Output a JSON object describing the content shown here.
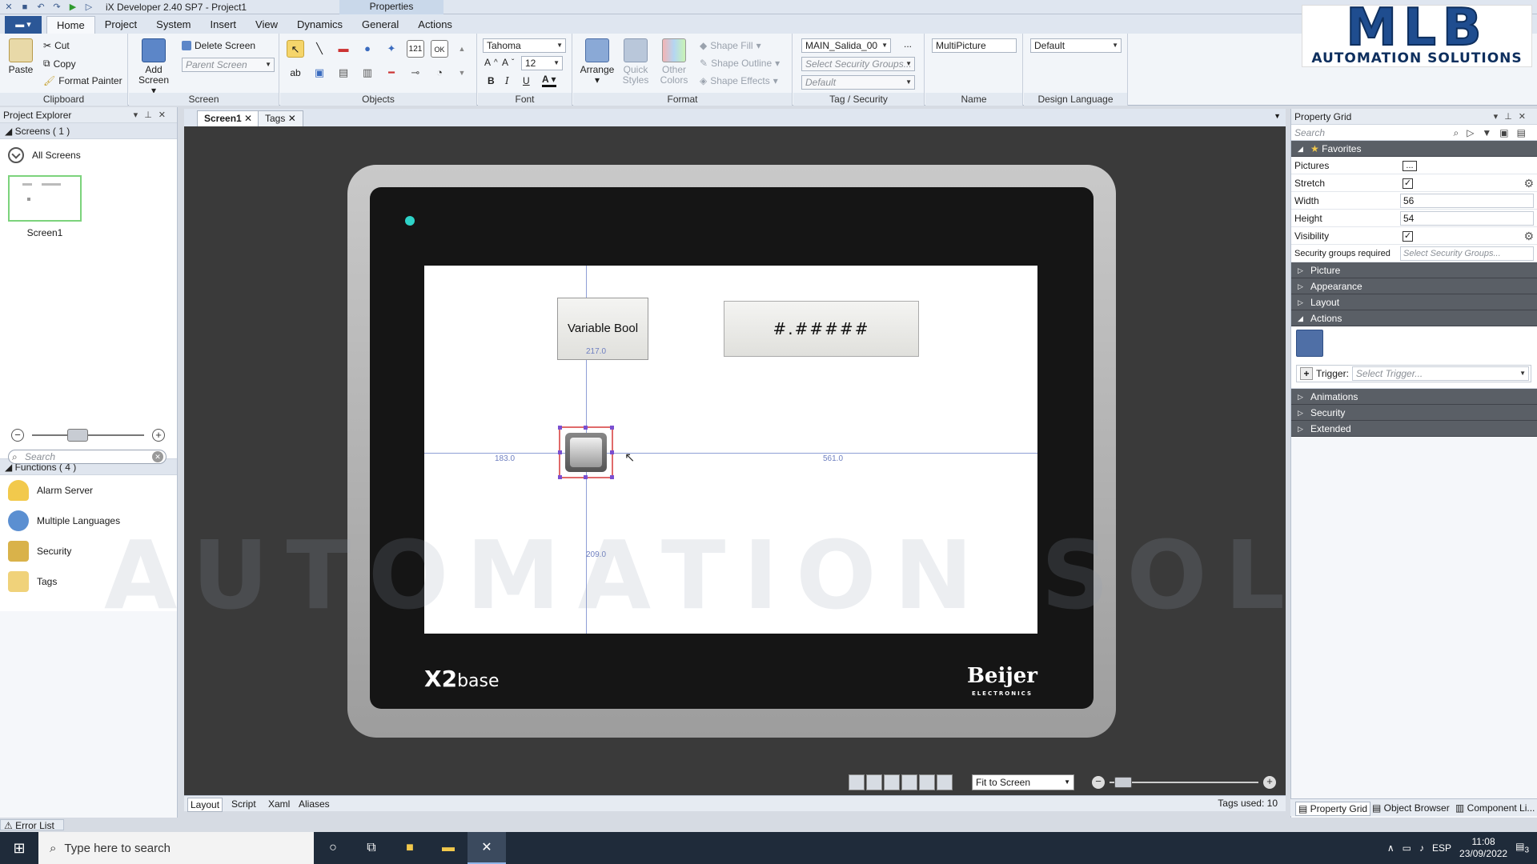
{
  "window": {
    "title": "iX Developer 2.40 SP7 - Project1",
    "context_tab": "Properties"
  },
  "ribbon_tabs": [
    "Home",
    "Project",
    "System",
    "Insert",
    "View",
    "Dynamics",
    "General",
    "Actions"
  ],
  "ribbon": {
    "clipboard": {
      "paste": "Paste",
      "cut": "Cut",
      "copy": "Copy",
      "format_painter": "Format Painter",
      "label": "Clipboard"
    },
    "screen": {
      "add_screen": "Add Screen",
      "delete_screen": "Delete Screen",
      "parent_screen": "Parent Screen",
      "label": "Screen"
    },
    "objects": {
      "label": "Objects"
    },
    "font": {
      "family": "Tahoma",
      "size": "12",
      "bold": "B",
      "italic": "I",
      "underline": "U",
      "label": "Font"
    },
    "format": {
      "arrange": "Arrange",
      "quick_styles": "Quick Styles",
      "other_colors": "Other Colors",
      "shape_fill": "Shape Fill",
      "shape_outline": "Shape Outline",
      "shape_effects": "Shape Effects",
      "label": "Format"
    },
    "tag_security": {
      "tag": "MAIN_Salida_00",
      "security_groups": "Select Security Groups...",
      "default": "Default",
      "label": "Tag / Security"
    },
    "name": {
      "value": "MultiPicture",
      "label": "Name"
    },
    "design_language": {
      "value": "Default",
      "label": "Design Language"
    }
  },
  "logo": {
    "main": "MLB",
    "sub": "AUTOMATION SOLUTIONS"
  },
  "watermark": "AUTOMATION SOLUTIONS",
  "project_explorer": {
    "title": "Project Explorer",
    "screens_header": "Screens ( 1 )",
    "all_screens": "All Screens",
    "screen_thumb": "Screen1",
    "search_placeholder": "Search",
    "functions_header": "Functions ( 4 )",
    "functions": [
      "Alarm Server",
      "Multiple Languages",
      "Security",
      "Tags"
    ]
  },
  "doc_tabs": [
    "Screen1",
    "Tags"
  ],
  "canvas": {
    "button_label": "Variable Bool",
    "numeric_display": "#.#####",
    "measure_top": "217.0",
    "measure_left": "183.0",
    "measure_right": "561.0",
    "measure_bottom": "209.0",
    "device_model": "X2",
    "device_model_suffix": "base",
    "device_brand": "Beijer",
    "device_brand_sub": "ELECTRONICS",
    "fit_mode": "Fit to Screen"
  },
  "bottom_tabs": [
    "Layout",
    "Script",
    "Xaml",
    "Aliases"
  ],
  "tags_used": "Tags used: 10",
  "property_grid": {
    "title": "Property Grid",
    "search_placeholder": "Search",
    "favorites": "Favorites",
    "rows": [
      {
        "key": "Pictures",
        "value": "..."
      },
      {
        "key": "Stretch",
        "value": "✓"
      },
      {
        "key": "Width",
        "value": "56"
      },
      {
        "key": "Height",
        "value": "54"
      },
      {
        "key": "Visibility",
        "value": "✓"
      },
      {
        "key": "Security groups required",
        "value": "Select Security Groups..."
      }
    ],
    "categories_before": [
      "Picture",
      "Appearance",
      "Layout"
    ],
    "actions": "Actions",
    "trigger_label": "Trigger:",
    "trigger_placeholder": "Select Trigger...",
    "categories_after": [
      "Animations",
      "Security",
      "Extended"
    ]
  },
  "right_tabs": [
    "Property Grid",
    "Object Browser",
    "Component Li..."
  ],
  "error_list": "Error List",
  "taskbar": {
    "search_placeholder": "Type here to search",
    "lang": "ESP",
    "time": "11:08",
    "date": "23/09/2022",
    "notifications": "3"
  },
  "colors": {
    "accent": "#2b5797",
    "selection": "#e06a6a",
    "guide": "#8f9fd6",
    "led": "#2ed3c8"
  }
}
